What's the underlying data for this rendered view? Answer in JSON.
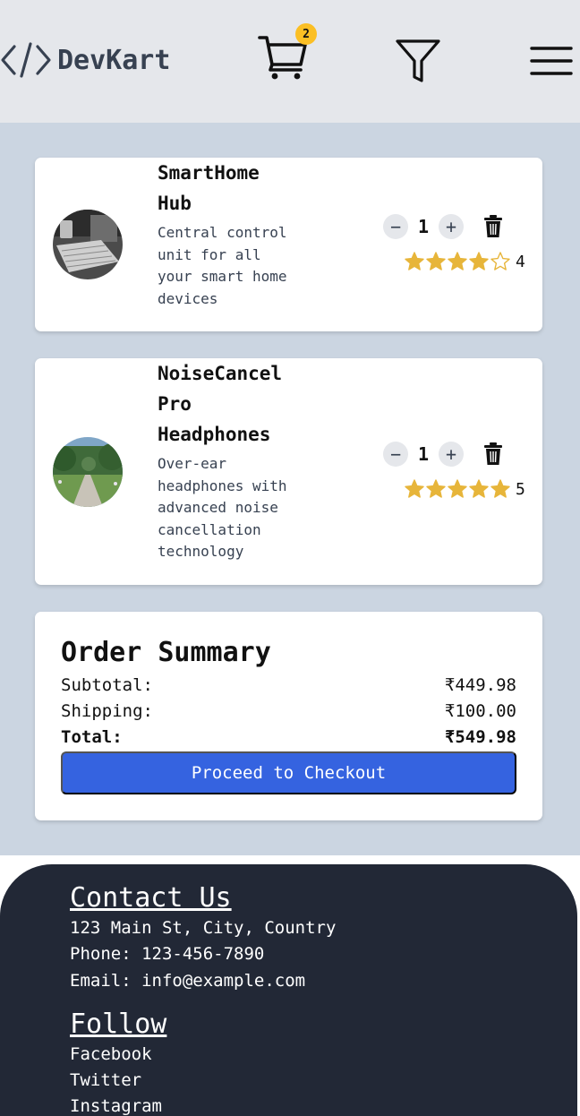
{
  "header": {
    "brand": "DevKart",
    "cart_count": "2",
    "icons": {
      "logo": "code-icon",
      "cart": "cart-icon",
      "filter": "filter-icon",
      "menu": "hamburger-menu-icon"
    }
  },
  "cart_items": [
    {
      "name": "SmartHome Hub",
      "description": "Central control unit for all your smart home devices",
      "quantity": "1",
      "rating": "4",
      "rating_value": 4,
      "max_rating": 5
    },
    {
      "name": "NoiseCancel Pro Headphones",
      "description": "Over-ear headphones with advanced noise cancellation technology",
      "quantity": "1",
      "rating": "5",
      "rating_value": 5,
      "max_rating": 5
    }
  ],
  "controls": {
    "decrement": "−",
    "increment": "+"
  },
  "summary": {
    "title": "Order Summary",
    "subtotal_label": "Subtotal:",
    "subtotal_value": "₹449.98",
    "shipping_label": "Shipping:",
    "shipping_value": "₹100.00",
    "total_label": "Total:",
    "total_value": "₹549.98",
    "checkout_label": "Proceed to Checkout"
  },
  "footer": {
    "contact_heading": "Contact Us",
    "address": "123 Main St, City, Country",
    "phone": "Phone: 123-456-7890",
    "email": "Email: info@example.com",
    "follow_heading": "Follow",
    "links": [
      "Facebook",
      "Twitter",
      "Instagram"
    ]
  },
  "colors": {
    "accent": "#3563e0",
    "star": "#e7b53a",
    "badge": "#fbbf24",
    "footer": "#222836",
    "page_bg": "#cbd5e1"
  }
}
